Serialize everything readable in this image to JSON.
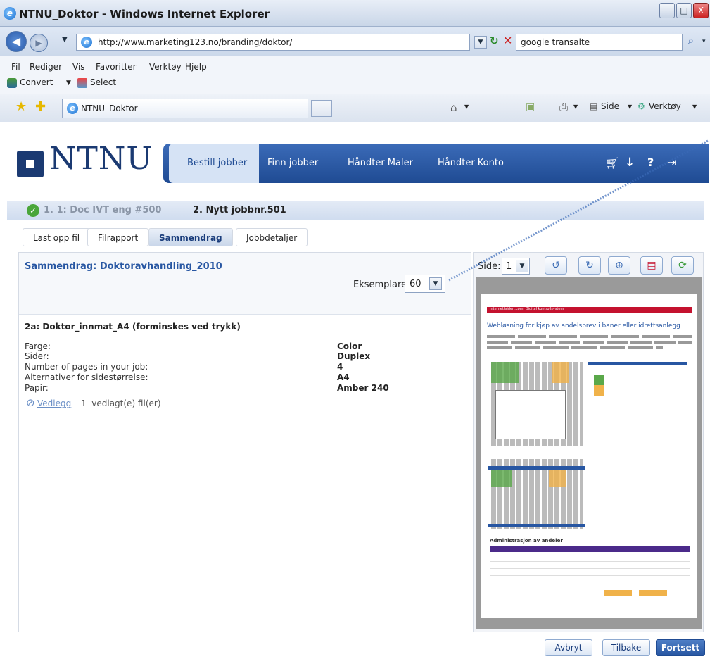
{
  "window": {
    "title": "NTNU_Doktor - Windows Internet Explorer"
  },
  "browser": {
    "address": "http://www.marketing123.no/branding/doktor/",
    "search": "google transalte",
    "menu": [
      "Fil",
      "Rediger",
      "Vis",
      "Favoritter",
      "Verktøy",
      "Hjelp"
    ],
    "toolbar_convert": "Convert",
    "toolbar_select": "Select",
    "tab_title": "NTNU_Doktor",
    "cmd_side": "Side",
    "cmd_tools": "Verktøy"
  },
  "site": {
    "logo_text": "NTNU",
    "nav": [
      "Bestill jobber",
      "Finn jobber",
      "Håndter Maler",
      "Håndter Konto"
    ],
    "nav_icons": [
      "cart-icon",
      "download-icon",
      "help-icon",
      "logout-icon"
    ]
  },
  "steps": {
    "done": "1. 1: Doc IVT eng #500",
    "current": "2. Nytt jobbnr.501"
  },
  "crumbs": [
    "Last opp fil",
    "Filrapport",
    "Sammendrag",
    "Jobbdetaljer"
  ],
  "summary": {
    "title": "Sammendrag: Doktoravhandling_2010",
    "copies_label": "Eksemplarer:",
    "copies_value": "60",
    "section_title": "2a: Doktor_innmat_A4 (forminskes ved trykk)",
    "rows": [
      {
        "label": "Farge:",
        "value": "Color"
      },
      {
        "label": "Sider:",
        "value": "Duplex"
      },
      {
        "label": "Number of pages in your job:",
        "value": "4"
      },
      {
        "label": "Alternativer for sidestørrelse:",
        "value": "A4"
      },
      {
        "label": "Papir:",
        "value": "Amber 240"
      }
    ],
    "attachment_link": "Vedlegg",
    "attachment_text": "1  vedlagt(e) fil(er)"
  },
  "viewer": {
    "page_label": "Side:",
    "page_value": "1"
  },
  "preview": {
    "banner": "Internettsiden.com: Digital kontrollsystem",
    "heading": "Webløsning for kjøp av andelsbrev i baner eller idrettsanlegg",
    "table_title": "Administrasjon av andeler"
  },
  "actions": {
    "cancel": "Avbryt",
    "back": "Tilbake",
    "continue": "Fortsett"
  },
  "colors": {
    "brand_blue": "#1b3a72",
    "nav_blue": "#2756a2",
    "accent_red": "#c4122f"
  }
}
